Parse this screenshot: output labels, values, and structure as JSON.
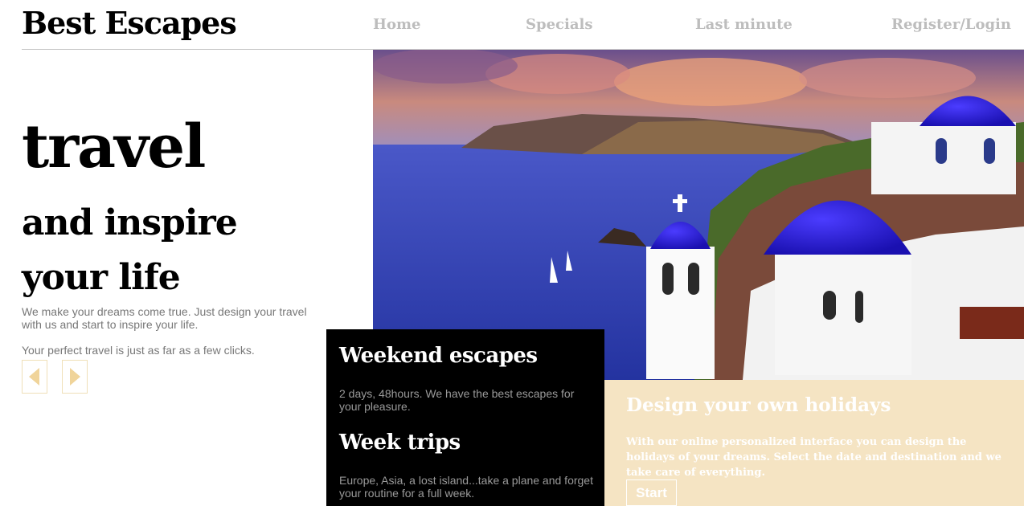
{
  "header": {
    "brand": "Best Escapes",
    "nav": [
      {
        "label": "Home"
      },
      {
        "label": "Specials"
      },
      {
        "label": "Last minute"
      },
      {
        "label": "Register/Login"
      }
    ]
  },
  "hero": {
    "headline_1": "travel",
    "headline_2": "and inspire",
    "headline_3": "your life",
    "lead": "We make your dreams come true. Just design your travel with us and start to inspire your life.",
    "lead_2": "Your perfect travel is just as far as a few clicks.",
    "prev_icon": "chevron-left-icon",
    "next_icon": "chevron-right-icon",
    "image_subject": "Santorini caldera with blue-domed churches"
  },
  "features": [
    {
      "title": "Weekend escapes",
      "text": "2 days, 48hours. We have the best escapes for your pleasure."
    },
    {
      "title": "Week trips",
      "text": "Europe, Asia, a lost island...take a plane and forget your routine for a full week."
    }
  ],
  "cta": {
    "title": "Design your own holidays",
    "text": "With our online personalized interface you can design the holidays of your dreams. Select the date and destination and we take care of everything.",
    "button": "Start"
  },
  "colors": {
    "accent_cream": "#f5e4c3",
    "nav_gray": "#bdbdbd",
    "dark_panel": "#000000",
    "arrow_gold": "#f0d49a"
  }
}
